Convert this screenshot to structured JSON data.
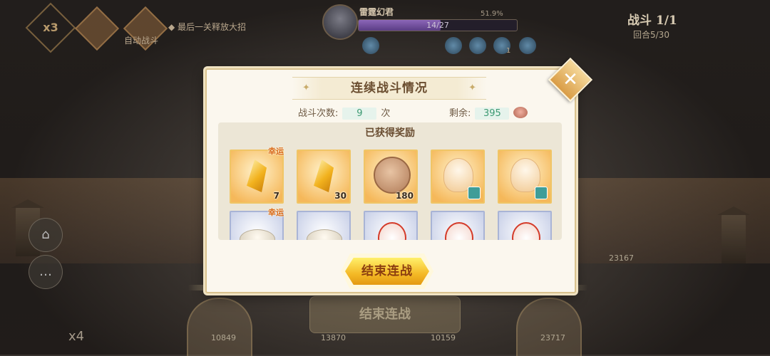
{
  "hud": {
    "multiplier": "x3",
    "auto_battle_label": "自动战斗",
    "auto_skill_label": "最后一关释放大招",
    "boss_name": "雷霆幻君",
    "boss_hp_text": "14/27",
    "boss_hp_percent": "51.9%",
    "boss_hp_fraction": 0.52,
    "battle_title": "战斗 1/1",
    "battle_round": "回合5/30",
    "buff_count": "1",
    "speed": "x4",
    "ghost_end_label": "结束连战",
    "hero_hp": [
      "10849",
      "13870",
      "10159",
      "23717"
    ],
    "ally_hp": "23167"
  },
  "dialog": {
    "title": "连续战斗情况",
    "battles_label": "战斗次数:",
    "battles_value": "9",
    "battles_unit": "次",
    "remaining_label": "剩余:",
    "remaining_value": "395",
    "rewards_heading": "已获得奖励",
    "end_button_label": "结束连战",
    "close_icon": "close-icon"
  },
  "rewards": [
    {
      "icon": "gold-crystal",
      "qty": "7",
      "lucky": "幸运",
      "style": "gold"
    },
    {
      "icon": "gold-crystal",
      "qty": "30",
      "lucky": "",
      "style": "gold"
    },
    {
      "icon": "medal-coin",
      "qty": "180",
      "lucky": "",
      "style": "gold"
    },
    {
      "icon": "chef-figure",
      "qty": "",
      "lucky": "",
      "style": "gold"
    },
    {
      "icon": "chef-figure",
      "qty": "",
      "lucky": "",
      "style": "gold"
    },
    {
      "icon": "dumpling",
      "qty": "",
      "lucky": "幸运",
      "style": "silver"
    },
    {
      "icon": "dumpling",
      "qty": "",
      "lucky": "",
      "style": "silver"
    },
    {
      "icon": "rooster",
      "qty": "",
      "lucky": "",
      "style": "silver"
    },
    {
      "icon": "rooster",
      "qty": "",
      "lucky": "",
      "style": "silver"
    },
    {
      "icon": "rooster",
      "qty": "",
      "lucky": "",
      "style": "silver"
    }
  ]
}
